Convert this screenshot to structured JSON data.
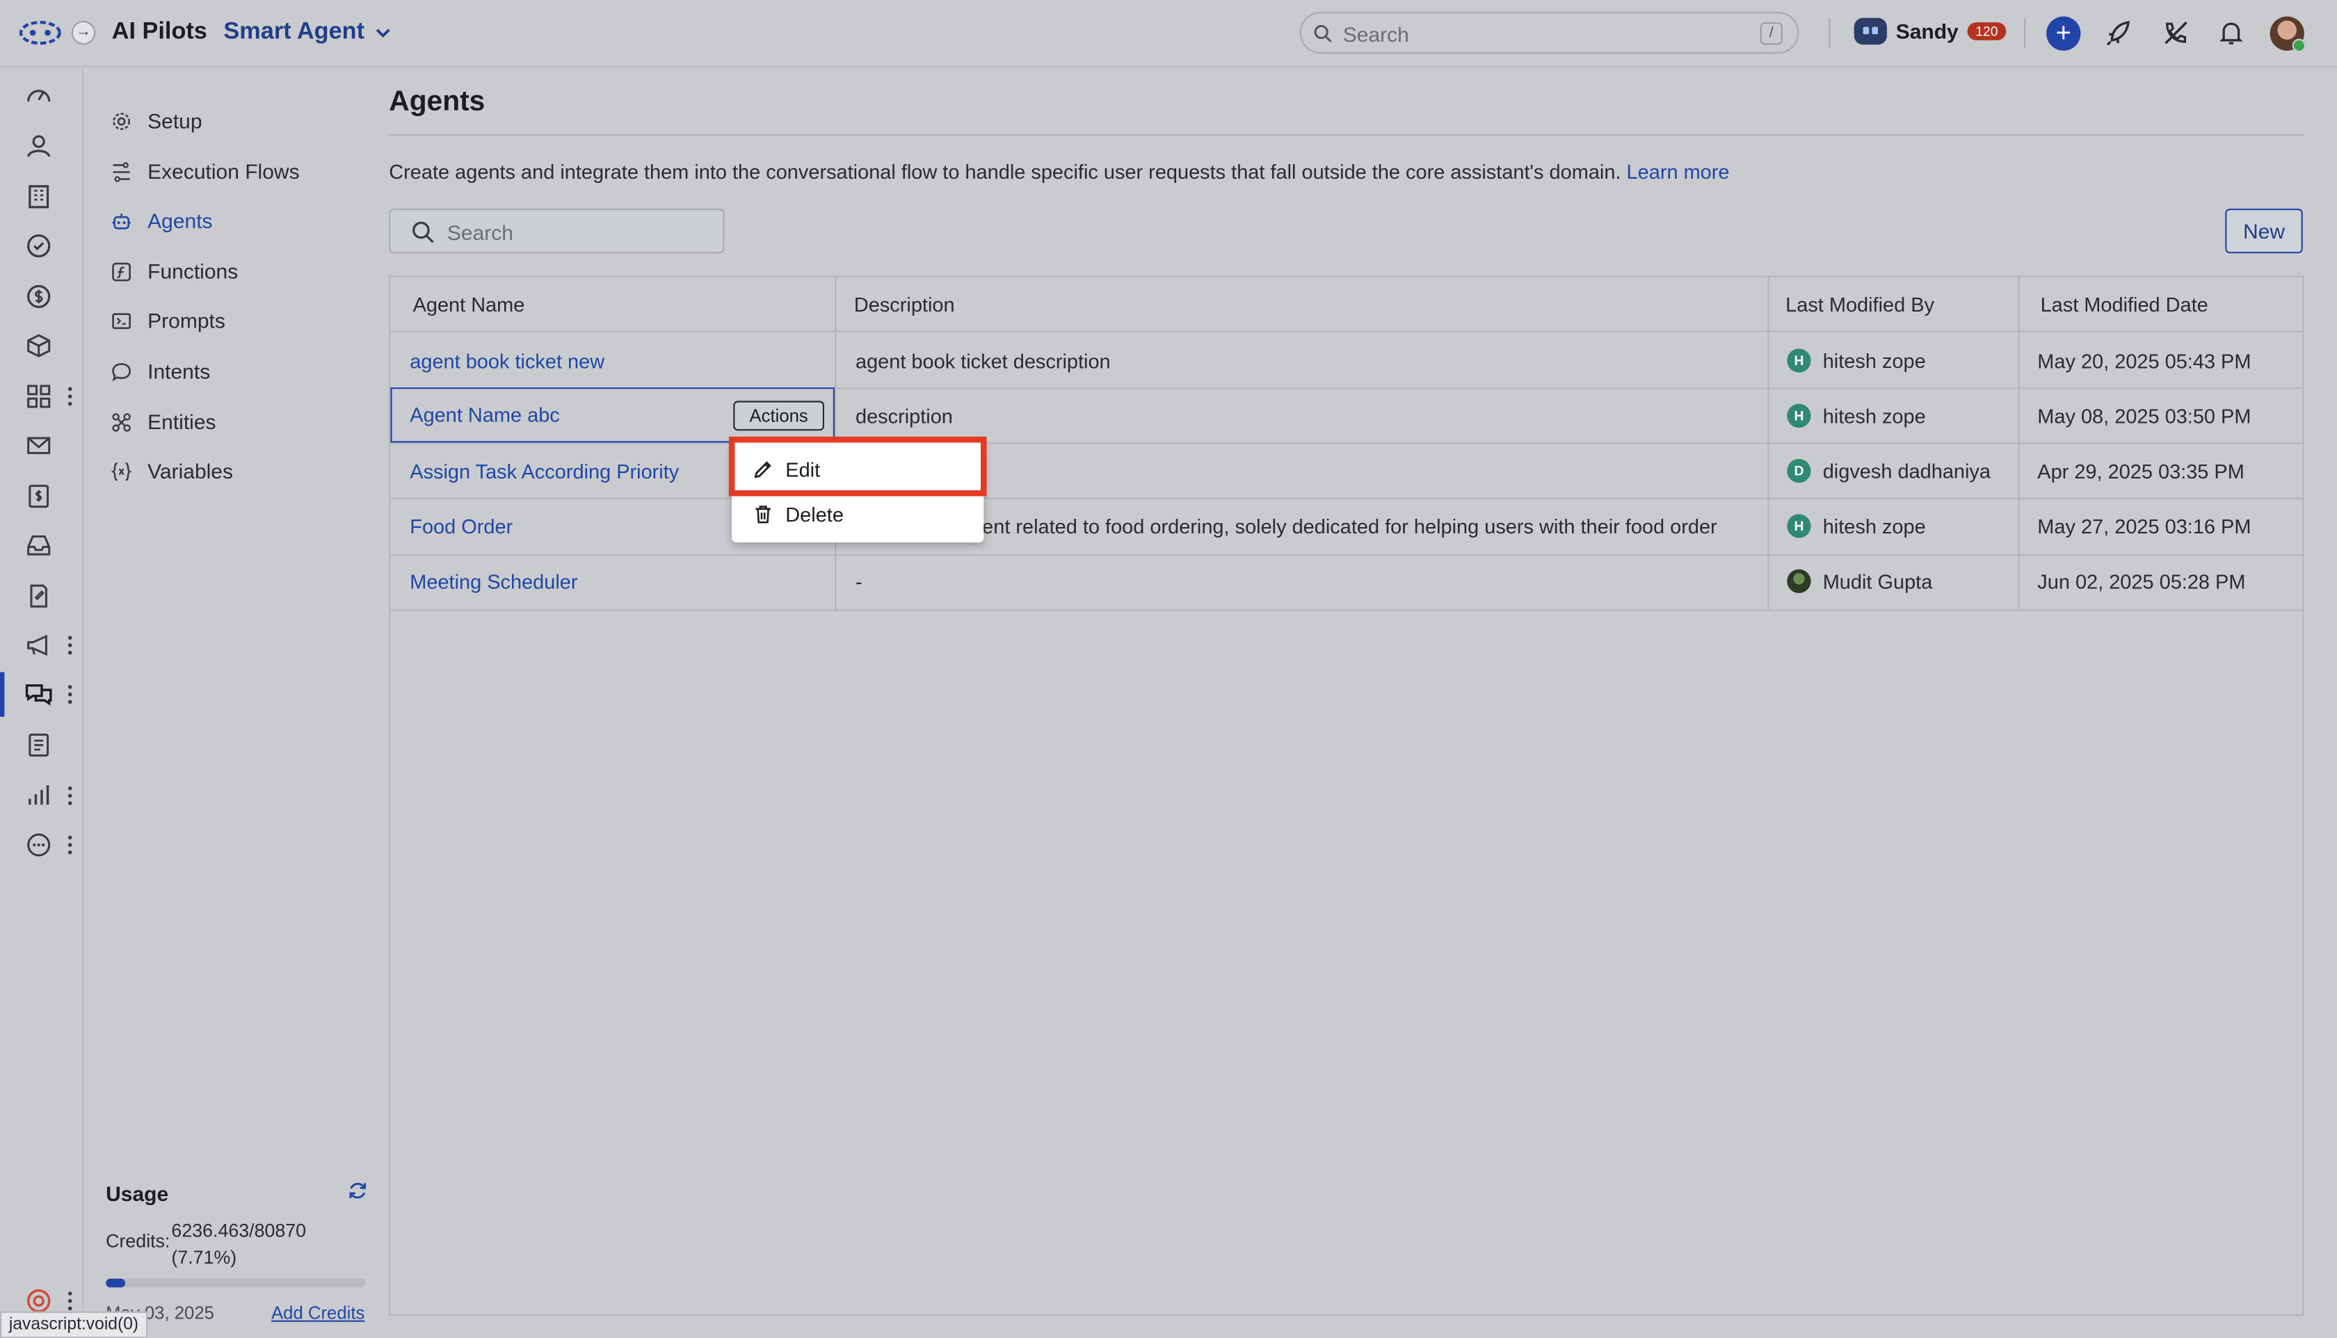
{
  "app": {
    "title": "AI Pilots",
    "switcher_label": "Smart Agent",
    "search_placeholder": "Search",
    "search_shortcut": "/",
    "user_name": "Sandy",
    "user_badge": "120"
  },
  "sidenav": {
    "items": [
      {
        "label": "Setup",
        "icon": "gear-icon"
      },
      {
        "label": "Execution Flows",
        "icon": "flow-icon"
      },
      {
        "label": "Agents",
        "icon": "robot-icon"
      },
      {
        "label": "Functions",
        "icon": "function-icon"
      },
      {
        "label": "Prompts",
        "icon": "prompt-icon"
      },
      {
        "label": "Intents",
        "icon": "chat-icon"
      },
      {
        "label": "Entities",
        "icon": "entities-icon"
      },
      {
        "label": "Variables",
        "icon": "variables-icon"
      }
    ],
    "active_index": 2,
    "usage": {
      "title": "Usage",
      "credits_label": "Credits:",
      "credits_value": "6236.463/80870",
      "credits_percent": "(7.71%)",
      "progress_fraction": 0.0771,
      "date": "May 03, 2025",
      "add_credits": "Add Credits"
    }
  },
  "main": {
    "title": "Agents",
    "description": "Create agents and integrate them into the conversational flow to handle specific user requests that fall outside the core assistant's domain.",
    "learn_more": "Learn more",
    "search_placeholder": "Search",
    "new_button": "New",
    "columns": [
      "Agent Name",
      "Description",
      "Last Modified By",
      "Last Modified Date"
    ],
    "rows": [
      {
        "name": "agent book ticket new",
        "description": "agent book ticket description",
        "user_initial": "H",
        "user": "hitesh zope",
        "date": "May 20, 2025 05:43 PM"
      },
      {
        "name": "Agent Name abc",
        "description": "description",
        "user_initial": "H",
        "user": "hitesh zope",
        "date": "May 08, 2025 03:50 PM"
      },
      {
        "name": "Assign Task According Priority",
        "description": "",
        "user_initial": "D",
        "user": "digvesh dadhaniya",
        "date": "Apr 29, 2025 03:35 PM"
      },
      {
        "name": "Food Order",
        "description": "ent related to food ordering, solely dedicated for helping users with their food order",
        "user_initial": "H",
        "user": "hitesh zope",
        "date": "May 27, 2025 03:16 PM"
      },
      {
        "name": "Meeting Scheduler",
        "description": "-",
        "user_initial": "",
        "user": "Mudit Gupta",
        "date": "Jun 02, 2025 05:28 PM"
      }
    ],
    "actions_button": "Actions",
    "menu": [
      {
        "label": "Edit",
        "icon": "pencil-icon"
      },
      {
        "label": "Delete",
        "icon": "trash-icon"
      }
    ]
  },
  "status_tip": "javascript:void(0)",
  "colors": {
    "accent": "#2044a8",
    "link": "#1f47a5",
    "highlight": "#e43b24",
    "badge": "#b4321f"
  }
}
